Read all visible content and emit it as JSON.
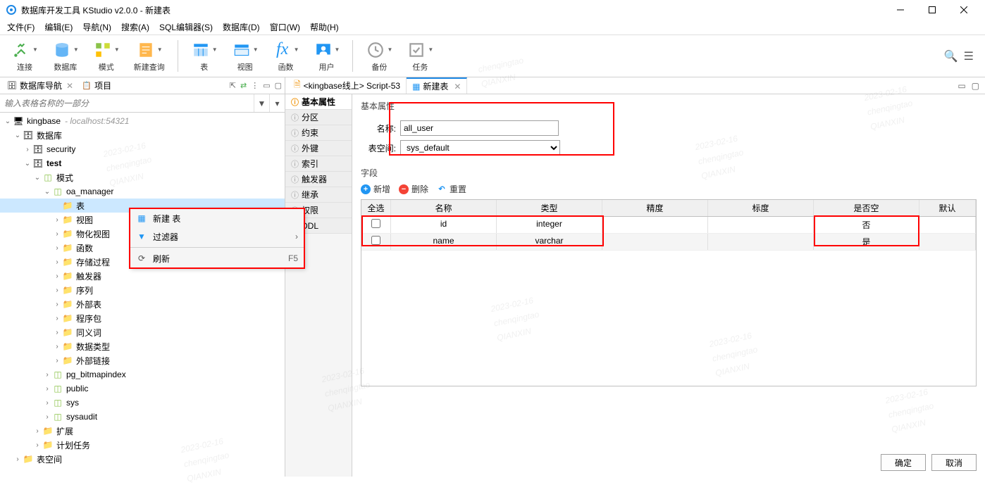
{
  "app": {
    "title": "数据库开发工具 KStudio v2.0.0 - 新建表"
  },
  "menubar": [
    "文件(F)",
    "编辑(E)",
    "导航(N)",
    "搜索(A)",
    "SQL编辑器(S)",
    "数据库(D)",
    "窗口(W)",
    "帮助(H)"
  ],
  "toolbar": [
    {
      "label": "连接",
      "color": "#4caf50"
    },
    {
      "label": "数据库",
      "color": "#2196f3"
    },
    {
      "label": "模式",
      "color": "#8bc34a"
    },
    {
      "label": "新建查询",
      "color": "#ff9800"
    },
    {
      "label": "表",
      "color": "#2196f3"
    },
    {
      "label": "视图",
      "color": "#2196f3"
    },
    {
      "label": "函数",
      "color": "#2196f3"
    },
    {
      "label": "用户",
      "color": "#2196f3"
    },
    {
      "label": "备份",
      "color": "#9e9e9e"
    },
    {
      "label": "任务",
      "color": "#9e9e9e"
    }
  ],
  "nav_tabs": {
    "db": "数据库导航",
    "project": "项目"
  },
  "filter_placeholder": "输入表格名称的一部分",
  "tree": {
    "root": {
      "label": "kingbase",
      "meta": "- localhost:54321"
    },
    "db": "数据库",
    "security": "security",
    "test": "test",
    "schema": "模式",
    "oa_manager": "oa_manager",
    "nodes": [
      "表",
      "视图",
      "物化视图",
      "函数",
      "存储过程",
      "触发器",
      "序列",
      "外部表",
      "程序包",
      "同义词",
      "数据类型",
      "外部链接"
    ],
    "others": [
      "pg_bitmapindex",
      "public",
      "sys",
      "sysaudit"
    ],
    "ext": "扩展",
    "task": "计划任务",
    "ts": "表空间"
  },
  "editor_tabs": {
    "script": "<kingbase线上> Script-53",
    "newtable": "新建表"
  },
  "prop_tabs": [
    "基本属性",
    "分区",
    "约束",
    "外键",
    "索引",
    "触发器",
    "继承",
    "权限",
    "DDL"
  ],
  "form": {
    "section": "基本属性",
    "name_label": "名称:",
    "name_value": "all_user",
    "ts_label": "表空间:",
    "ts_value": "sys_default"
  },
  "fields": {
    "title": "字段",
    "actions": {
      "add": "新增",
      "del": "删除",
      "reset": "重置"
    },
    "columns": [
      "全选",
      "名称",
      "类型",
      "精度",
      "标度",
      "是否空",
      "默认"
    ],
    "rows": [
      {
        "name": "id",
        "type": "integer",
        "nullable": "否"
      },
      {
        "name": "name",
        "type": "varchar",
        "nullable": "是"
      }
    ]
  },
  "context_menu": {
    "new_table": "新建 表",
    "filter": "过滤器",
    "refresh": "刷新",
    "refresh_key": "F5"
  },
  "footer": {
    "ok": "确定",
    "cancel": "取消"
  },
  "watermark": {
    "line1": "chenqingtao",
    "line2": "QIANXIN",
    "date": "2023-02-16"
  }
}
